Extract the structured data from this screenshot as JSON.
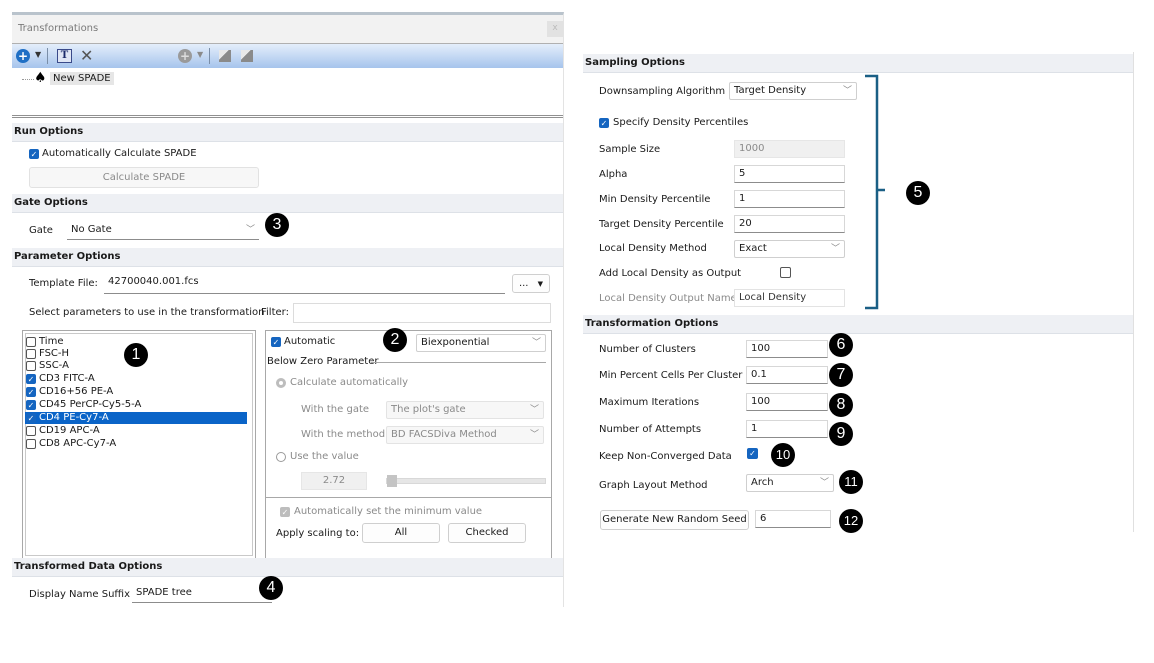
{
  "left_panel": {
    "title": "Transformations",
    "close_label": "x",
    "toolbar": {
      "add_icon": "plus-circle",
      "rename_icon": "text-T",
      "delete_icon": "x-mark",
      "add2_icon": "plus-circle-disabled",
      "copy_icon": "copy",
      "paste_icon": "paste"
    },
    "tree": [
      {
        "icon": "spade-icon",
        "label": "New SPADE"
      }
    ],
    "run_options": {
      "header": "Run Options",
      "auto_calc_label": "Automatically Calculate SPADE",
      "auto_calc_checked": true,
      "calc_button": "Calculate SPADE"
    },
    "gate_options": {
      "header": "Gate Options",
      "gate_label": "Gate",
      "gate_value": "No Gate"
    },
    "parameter_options": {
      "header": "Parameter Options",
      "template_label": "Template File:",
      "template_value": "42700040.001.fcs",
      "browse_label": "...",
      "select_label": "Select parameters to use in the transformation",
      "filter_label": "Filter:",
      "filter_value": "",
      "parameters": [
        {
          "label": "Time",
          "checked": false,
          "selected": false
        },
        {
          "label": "FSC-H",
          "checked": false,
          "selected": false
        },
        {
          "label": "SSC-A",
          "checked": false,
          "selected": false
        },
        {
          "label": "CD3 FITC-A",
          "checked": true,
          "selected": false
        },
        {
          "label": "CD16+56 PE-A",
          "checked": true,
          "selected": false
        },
        {
          "label": "CD45 PerCP-Cy5-5-A",
          "checked": true,
          "selected": false
        },
        {
          "label": "CD4 PE-Cy7-A",
          "checked": true,
          "selected": true
        },
        {
          "label": "CD19 APC-A",
          "checked": false,
          "selected": false
        },
        {
          "label": "CD8 APC-Cy7-A",
          "checked": false,
          "selected": false
        }
      ],
      "scaling": {
        "automatic_label": "Automatic",
        "automatic_checked": true,
        "type_value": "Biexponential",
        "below_zero_label": "Below Zero Parameter",
        "calc_auto_label": "Calculate automatically",
        "with_gate_label": "With the gate",
        "with_gate_value": "The plot's gate",
        "with_method_label": "With the method",
        "with_method_value": "BD FACSDiva Method",
        "use_value_label": "Use the value",
        "use_value": "2.72",
        "auto_min_label": "Automatically set the minimum value",
        "apply_label": "Apply scaling to:",
        "all_button": "All",
        "checked_button": "Checked"
      }
    },
    "transformed_options": {
      "header": "Transformed Data Options",
      "suffix_label": "Display Name Suffix",
      "suffix_value": "SPADE tree"
    }
  },
  "right_panel": {
    "sampling": {
      "header": "Sampling Options",
      "algorithm_label": "Downsampling Algorithm",
      "algorithm_value": "Target Density",
      "specify_label": "Specify Density Percentiles",
      "specify_checked": true,
      "sample_size_label": "Sample Size",
      "sample_size_value": "1000",
      "alpha_label": "Alpha",
      "alpha_value": "5",
      "min_density_label": "Min Density Percentile",
      "min_density_value": "1",
      "target_density_label": "Target Density Percentile",
      "target_density_value": "20",
      "local_method_label": "Local Density Method",
      "local_method_value": "Exact",
      "add_local_label": "Add Local Density as Output",
      "add_local_checked": false,
      "local_output_label": "Local Density Output Name",
      "local_output_value": "Local Density"
    },
    "transformation": {
      "header": "Transformation Options",
      "clusters_label": "Number of Clusters",
      "clusters_value": "100",
      "min_percent_label": "Min Percent Cells Per Cluster",
      "min_percent_value": "0.1",
      "max_iter_label": "Maximum Iterations",
      "max_iter_value": "100",
      "attempts_label": "Number of Attempts",
      "attempts_value": "1",
      "keep_label": "Keep Non-Converged Data",
      "keep_checked": true,
      "layout_label": "Graph Layout Method",
      "layout_value": "Arch",
      "seed_button": "Generate New Random Seed",
      "seed_value": "6"
    }
  },
  "callouts": [
    "1",
    "2",
    "3",
    "4",
    "5",
    "6",
    "7",
    "8",
    "9",
    "10",
    "11",
    "12"
  ],
  "colors": {
    "accent": "#1565c0",
    "selection": "#0a64c8",
    "bracket": "#1a5f85",
    "toolbar_gradient_top": "#e4eefb",
    "toolbar_gradient_bottom": "#a6c4ec"
  }
}
